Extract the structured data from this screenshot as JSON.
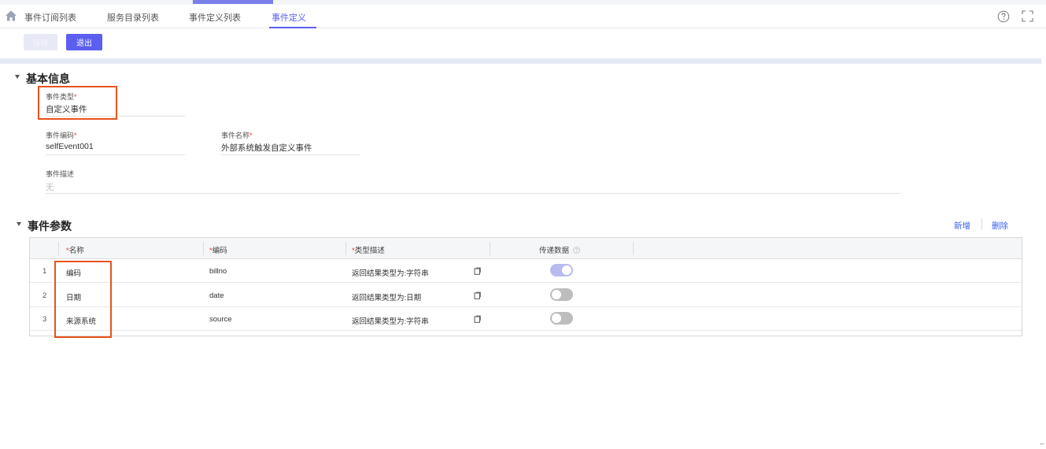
{
  "tabs": [
    {
      "label": "事件订阅列表"
    },
    {
      "label": "服务目录列表"
    },
    {
      "label": "事件定义列表"
    },
    {
      "label": "事件定义",
      "active": true
    }
  ],
  "toolbar": {
    "save_label": "保存",
    "exit_label": "退出"
  },
  "basic_info": {
    "title": "基本信息",
    "fields": {
      "event_type": {
        "label": "事件类型",
        "value": "自定义事件",
        "required": true
      },
      "event_code": {
        "label": "事件编码",
        "value": "selfEvent001",
        "required": true
      },
      "event_name": {
        "label": "事件名称",
        "value": "外部系统触发自定义事件",
        "required": true
      },
      "event_desc": {
        "label": "事件描述",
        "value": "无",
        "required": false
      }
    }
  },
  "params": {
    "title": "事件参数",
    "add_label": "新增",
    "delete_label": "删除",
    "columns": {
      "name": "名称",
      "code": "编码",
      "type_desc": "类型描述",
      "transfer": "传递数据"
    },
    "rows": [
      {
        "index": "1",
        "name": "编码",
        "code": "billno",
        "type_desc": "返回结果类型为:字符串",
        "transfer": true
      },
      {
        "index": "2",
        "name": "日期",
        "code": "date",
        "type_desc": "返回结果类型为:日期",
        "transfer": false
      },
      {
        "index": "3",
        "name": "来源系统",
        "code": "source",
        "type_desc": "返回结果类型为:字符串",
        "transfer": false
      }
    ]
  },
  "colors": {
    "accent": "#5b5ff0",
    "highlight": "#e8521c",
    "link": "#3b5ee8",
    "required": "#ee3333"
  },
  "icons": [
    "home-icon",
    "help-icon",
    "fullscreen-icon",
    "copy-icon",
    "question-circle-icon"
  ]
}
